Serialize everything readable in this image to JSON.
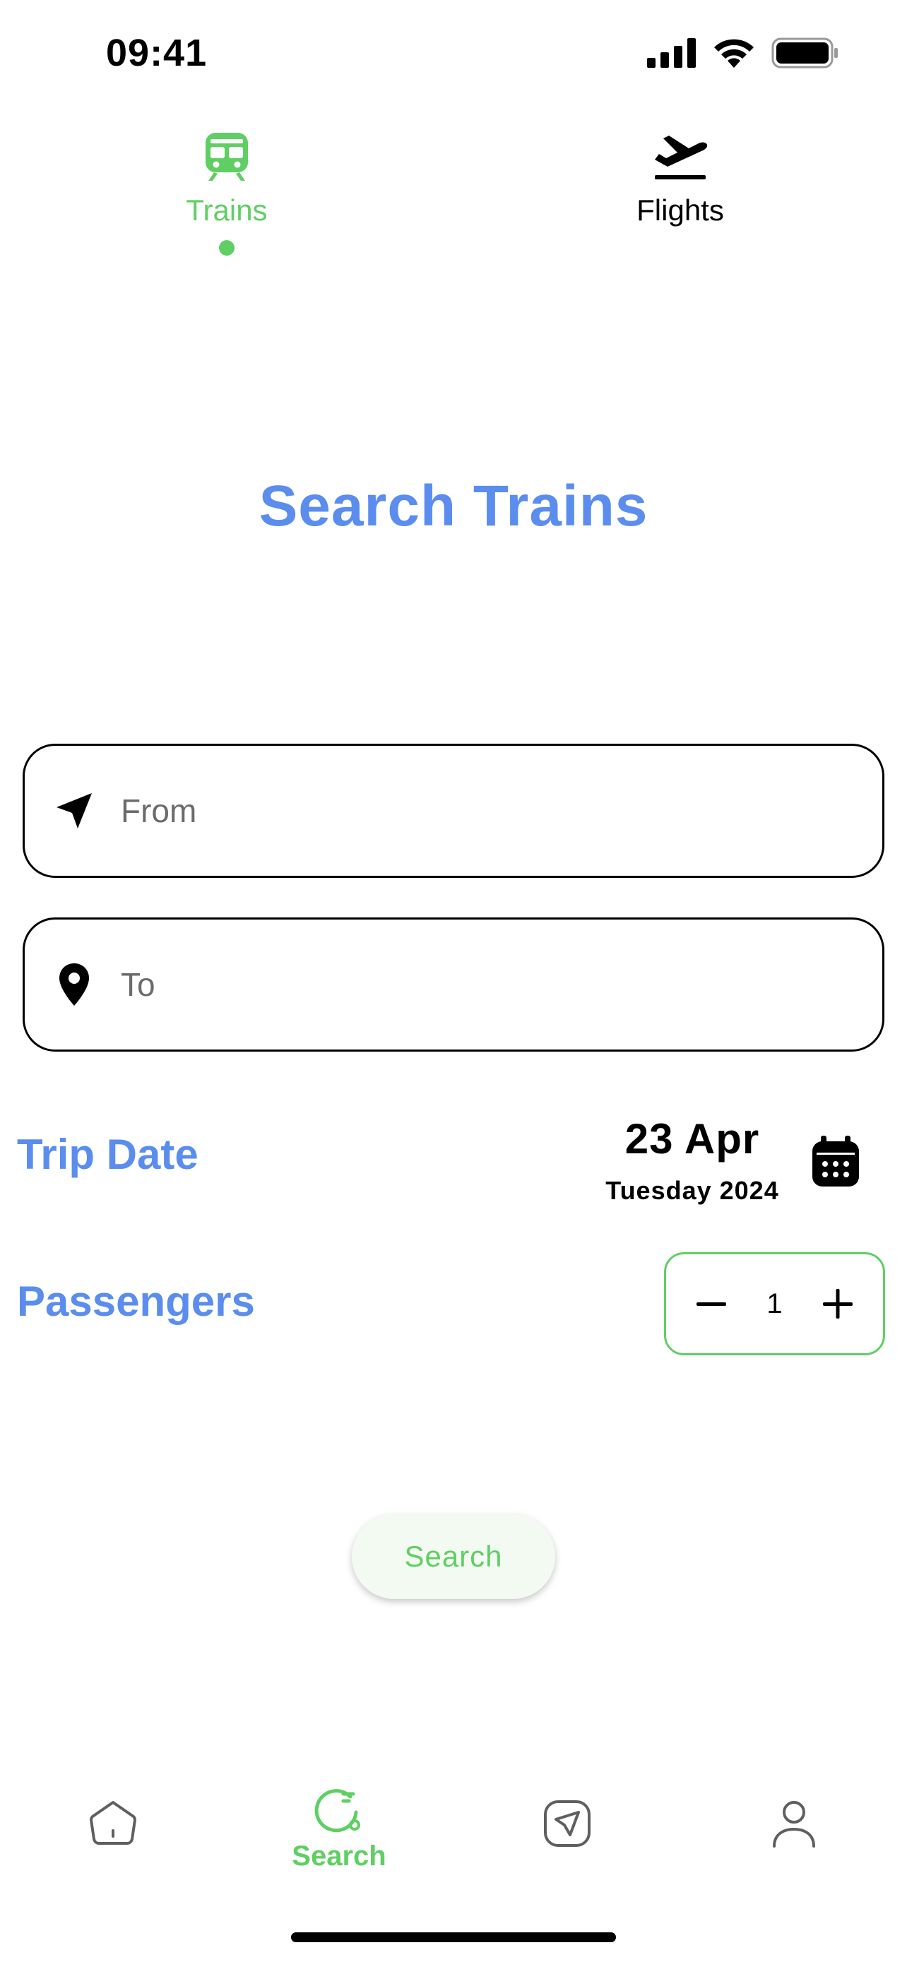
{
  "status_bar": {
    "time": "09:41"
  },
  "mode_tabs": [
    {
      "label": "Trains",
      "icon": "train-icon",
      "active": true
    },
    {
      "label": "Flights",
      "icon": "airplane-takeoff-icon",
      "active": false
    }
  ],
  "page_title": "Search Trains",
  "from_field": {
    "placeholder": "From",
    "value": "",
    "icon": "navigation-arrow-icon"
  },
  "to_field": {
    "placeholder": "To",
    "value": "",
    "icon": "map-pin-icon"
  },
  "trip_date": {
    "label": "Trip Date",
    "day_month": "23 Apr",
    "weekday_year": "Tuesday 2024",
    "icon": "calendar-icon"
  },
  "passengers": {
    "label": "Passengers",
    "count": "1"
  },
  "search_button": {
    "label": "Search"
  },
  "bottom_nav": {
    "items": [
      {
        "icon": "home-icon",
        "label": ""
      },
      {
        "icon": "search-icon",
        "label": "Search",
        "active": true
      },
      {
        "icon": "send-icon",
        "label": ""
      },
      {
        "icon": "user-icon",
        "label": ""
      }
    ]
  },
  "colors": {
    "accent_green": "#5fcf63",
    "title_blue": "#5b8def",
    "text_black": "#000000"
  }
}
